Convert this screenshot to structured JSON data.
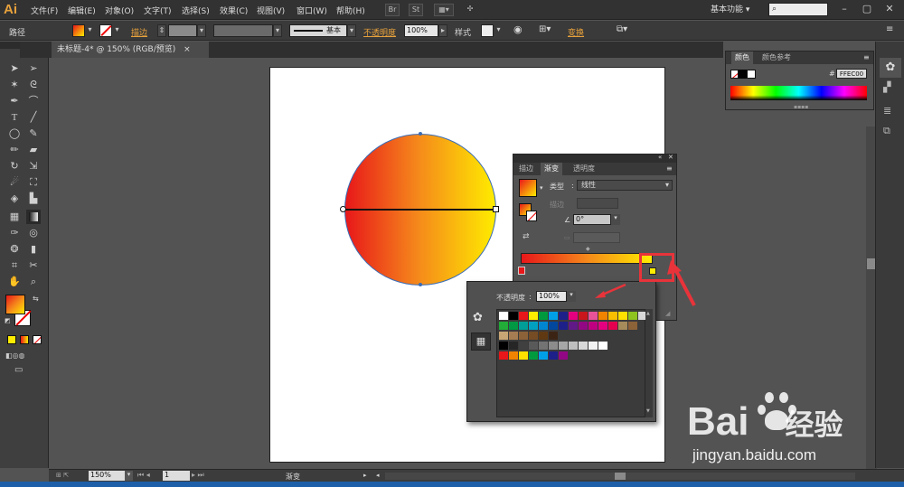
{
  "app": {
    "logo": "Ai",
    "workspace": "基本功能",
    "search_icon": "search-icon"
  },
  "menu": [
    "文件(F)",
    "编辑(E)",
    "对象(O)",
    "文字(T)",
    "选择(S)",
    "效果(C)",
    "视图(V)",
    "窗口(W)",
    "帮助(H)"
  ],
  "menubar_buttons": {
    "br": "Br",
    "st": "St"
  },
  "control": {
    "object_type": "路径",
    "stroke_label": "描边",
    "stroke_style": "基本",
    "opacity_label": "不透明度",
    "opacity_value": "100%",
    "style_label": "样式",
    "transform_label": "变换"
  },
  "document": {
    "tab_title": "未标题-4* @ 150% (RGB/预览)",
    "close": "×"
  },
  "color_panel": {
    "tabs": [
      "颜色",
      "颜色参考"
    ],
    "hash": "#",
    "hex": "FFEC00"
  },
  "gradient_panel": {
    "tabs": [
      "描边",
      "渐变",
      "透明度"
    ],
    "type_label": "类型",
    "type_value": "线性",
    "stroke_label": "描边",
    "angle_value": "0°",
    "angle_symbol": "∠",
    "colors": {
      "start": "#e8171a",
      "mid": "#f5881b",
      "end": "#ffec00"
    }
  },
  "swatch_panel": {
    "opacity_label": "不透明度",
    "opacity_value": "100%"
  },
  "status": {
    "zoom": "150%",
    "page": "1",
    "tool_name": "渐变"
  },
  "watermark": {
    "brand_a": "Bai",
    "brand_b": "经验",
    "url": "jingyan.baidu.com"
  },
  "swatch_rows": [
    [
      "#ffffff",
      "#000000",
      "#e8171a",
      "#ffed00",
      "#009a3e",
      "#00a0e9",
      "#1d2088",
      "#e4007f",
      "#c9161d",
      "#e85298",
      "#f08300",
      "#fabe00",
      "#ffe100",
      "#8fc31f",
      "#d7d7d7"
    ],
    [
      "#22ac38",
      "#009944",
      "#009e96",
      "#00a0c1",
      "#0086d1",
      "#00479d",
      "#1d2088",
      "#601986",
      "#920783",
      "#be0081",
      "#e4007f",
      "#e5004f",
      "#a68b5b",
      "#8c6239"
    ],
    [
      "#c7a574",
      "#a67c52",
      "#8c6239",
      "#754c24",
      "#603913",
      "#3c2415"
    ],
    [
      "#000000",
      "#262626",
      "#404040",
      "#595959",
      "#737373",
      "#8c8c8c",
      "#a6a6a6",
      "#bfbfbf",
      "#d9d9d9",
      "#f2f2f2",
      "#ffffff"
    ],
    [
      "#e8171a",
      "#f08300",
      "#ffe100",
      "#009a3e",
      "#00a0e9",
      "#1d2088",
      "#920783"
    ]
  ],
  "tool_icons": [
    "select-arrow-icon",
    "direct-select-icon",
    "magic-wand-icon",
    "lasso-icon",
    "pen-icon",
    "curvature-icon",
    "type-icon",
    "line-icon",
    "ellipse-icon",
    "paintbrush-icon",
    "pencil-icon",
    "eraser-icon",
    "rotate-icon",
    "scale-icon",
    "warp-icon",
    "free-transform-icon",
    "shape-builder-icon",
    "perspective-icon",
    "mesh-icon",
    "gradient-icon",
    "eyedropper-icon",
    "blend-icon",
    "symbol-sprayer-icon",
    "column-graph-icon",
    "artboard-icon",
    "slice-icon",
    "hand-icon",
    "zoom-icon"
  ]
}
